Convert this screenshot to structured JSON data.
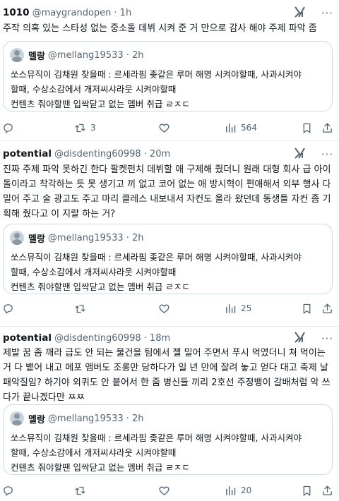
{
  "tweets": [
    {
      "name": "1010",
      "handle": "@maygrandopen",
      "time": "· 1h",
      "more": "···",
      "body": [
        "주작 의혹 있는 스타성 없는 중소돌 데뷔 시켜 준 거 만으로 감사 해야 주제 파악 좀"
      ],
      "quote": {
        "name": "멜랑",
        "handle": "@mellang19533 · 2h",
        "lines": [
          "쏘스뮤직이 김채원 찾을때 : 르세라핌 좆같은 루머 해명 시켜야할때, 사과시켜야",
          "할때, 수상소감에서 개저씨샤라웃 시켜야할때",
          "컨텐츠 줘야할땐 입싹닫고 없는 멤버 취급 ㄹㅈㄷ"
        ]
      },
      "stats": {
        "replies": "",
        "retweets": "3",
        "likes": "",
        "views": "564"
      }
    },
    {
      "name": "potential",
      "handle": "@disdenting60998",
      "time": "· 20m",
      "more": "···",
      "body": [
        "진짜 주제 파악 못하긴 한다 팔켓펀치 데뷔할 애 구제해 줬더니 원래 대형 회사 급 아이",
        "돌이라고 착각하는 듯 못 생기고 끼 없고 코어 없는 애 방시혁이 편애해서 외부 행사 다",
        "밀어 주고 술 광고도 주고 마리 클레스 내보내서 자컨도 올라 왔던데 동생들 자컨 좀 기",
        "획해 줬다고 이 지랄 하는 거?"
      ],
      "quote": {
        "name": "멜랑",
        "handle": "@mellang19533 · 2h",
        "lines": [
          "쏘스뮤직이 김채원 찾을때 : 르세라핌 좆같은 루머 해명 시켜야할때, 사과시켜야",
          "할때, 수상소감에서 개저씨샤라웃 시켜야할때",
          "컨텐츠 줘야할땐 입싹닫고 없는 멤버 취급 ㄹㅈㄷ"
        ]
      },
      "stats": {
        "replies": "",
        "retweets": "",
        "likes": "",
        "views": "25"
      }
    },
    {
      "name": "potential",
      "handle": "@disdenting60998",
      "time": "· 18m",
      "more": "···",
      "body": [
        "제발 꿈 좀 깨라 급도 안 되는 물건을 팀에서 젤 밀어 주면서 푸시 먹였더니 쳐 먹이는",
        "거 다 뱉어 내고 메포 앰버도 조롱만 당하다가 일 년 만에 잘려 놓고 얻다 대고 축제 날",
        "패악질임? 하기야 외퀴도 안 붙어서 한 줌 병신들 끼리 2호선 주정뱅이 갈배처럼 악 쓰",
        "다가 끝나겠다만 ㅉㅉ"
      ],
      "quote": {
        "name": "멜랑",
        "handle": "@mellang19533 · 2h",
        "lines": [
          "쏘스뮤직이 김채원 찾을때 : 르세라핌 좆같은 루머 해명 시켜야할때, 사과시켜야",
          "할때, 수상소감에서 개저씨샤라웃 시켜야할때",
          "컨텐츠 줘야할땐 입싹닫고 없는 멤버 취급 ㄹㅈㄷ"
        ]
      },
      "stats": {
        "replies": "",
        "retweets": "",
        "likes": "",
        "views": "20"
      }
    }
  ],
  "icons": {
    "grok": "grok-icon",
    "reply": "reply-icon",
    "retweet": "retweet-icon",
    "like": "heart-icon",
    "views": "views-icon",
    "bookmark": "bookmark-icon",
    "share": "share-icon"
  },
  "colors": {
    "text": "#0f1419",
    "secondary": "#536471",
    "border": "#cfd9de",
    "divider": "#e6e9ec"
  }
}
